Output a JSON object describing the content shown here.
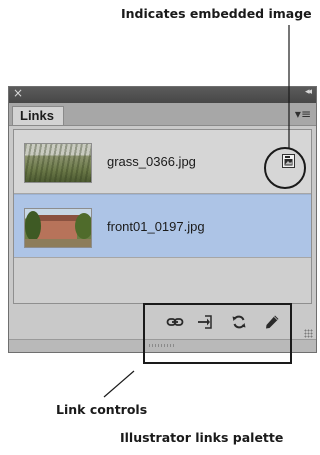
{
  "annotations": {
    "embedded_label": "Indicates embedded image",
    "controls_label": "Link  controls",
    "caption": "Illustrator links palette"
  },
  "panel": {
    "close_glyph": "×",
    "collapse_glyph": "◂◂",
    "tab_label": "Links",
    "menu_glyph": "▾≡"
  },
  "links": [
    {
      "filename": "grass_0366.jpg",
      "thumbnail": "grass-photo",
      "embedded": true,
      "selected": false
    },
    {
      "filename": "front01_0197.jpg",
      "thumbnail": "house-photo",
      "embedded": false,
      "selected": true
    }
  ],
  "toolbar": {
    "buttons": [
      {
        "name": "relink",
        "icon": "link-icon"
      },
      {
        "name": "go-to-link",
        "icon": "go-to-link-icon"
      },
      {
        "name": "update-link",
        "icon": "refresh-icon"
      },
      {
        "name": "edit-original",
        "icon": "pencil-icon"
      }
    ]
  },
  "colors": {
    "selected_row": "#adc4e6",
    "panel_bg": "#c9c9c9",
    "titlebar": "#4f4f4f"
  }
}
